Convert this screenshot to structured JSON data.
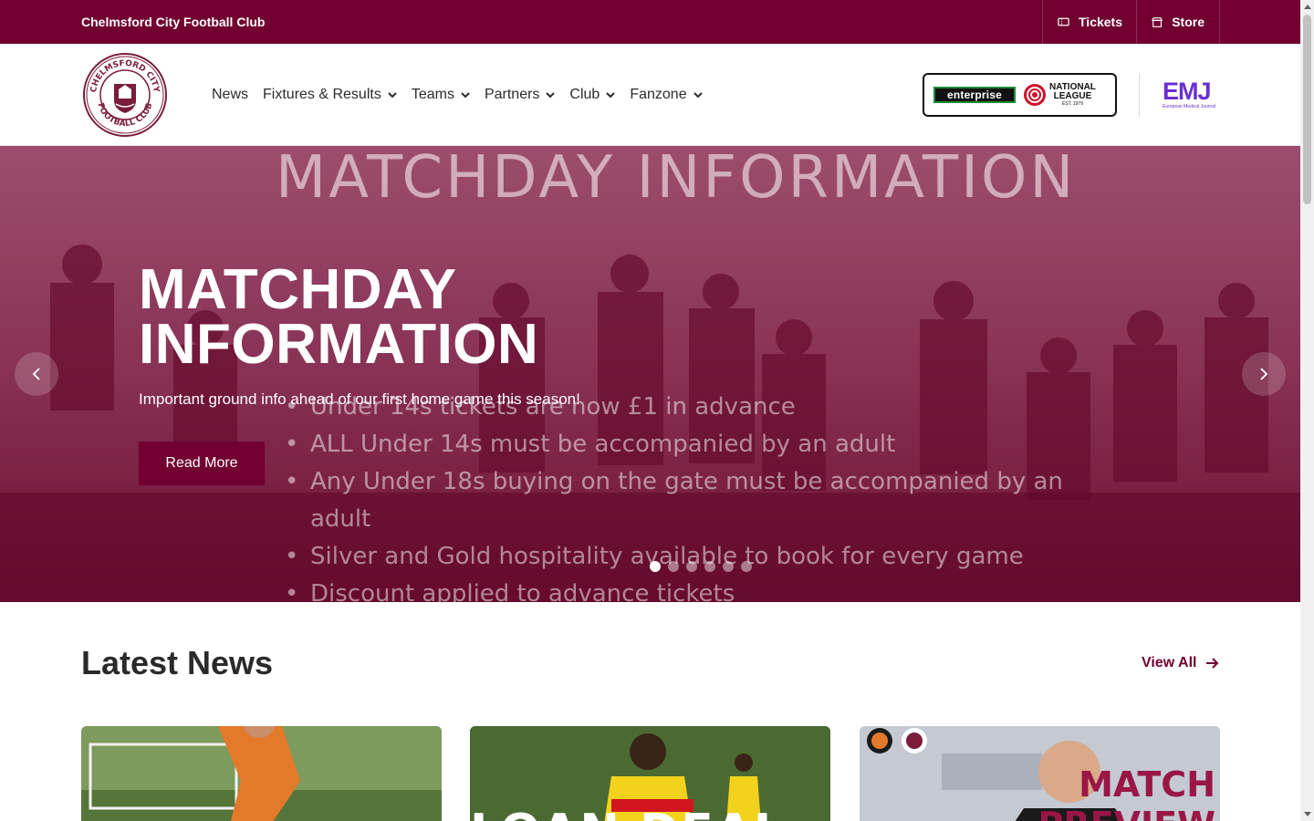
{
  "topbar": {
    "club_name": "Chelmsford City Football Club",
    "tickets_label": "Tickets",
    "store_label": "Store"
  },
  "header": {
    "crest_text": "CHELMSFORD CITY FOOTBALL CLUB",
    "nav": [
      {
        "label": "News",
        "has_dropdown": false
      },
      {
        "label": "Fixtures & Results",
        "has_dropdown": true
      },
      {
        "label": "Teams",
        "has_dropdown": true
      },
      {
        "label": "Partners",
        "has_dropdown": true
      },
      {
        "label": "Club",
        "has_dropdown": true
      },
      {
        "label": "Fanzone",
        "has_dropdown": true
      }
    ],
    "sponsor_enterprise": "enterprise",
    "sponsor_national_league": {
      "line1": "NATIONAL",
      "line2": "LEAGUE",
      "line3": "EST. 1979"
    },
    "sponsor_emj": {
      "mark": "EMJ",
      "sub": "European Medical Journal"
    }
  },
  "hero": {
    "background_heading": "MATCHDAY INFORMATION",
    "background_list": [
      "Under 14s tickets are now £1 in advance",
      "ALL Under 14s must be accompanied by an adult",
      "Any Under 18s buying on the gate must be accompanied by an adult",
      "Silver and Gold hospitality available to book for every game",
      "Discount applied to advance tickets"
    ],
    "title_line1": "MATCHDAY",
    "title_line2": "INFORMATION",
    "subtitle": "Important ground info ahead of our first home game this season!",
    "button_label": "Read More",
    "slide_count": 6,
    "active_slide": 0
  },
  "news": {
    "title": "Latest News",
    "view_all_label": "View All",
    "cards": [
      {
        "overlay_text": ""
      },
      {
        "overlay_text": "LOAN DEAL"
      },
      {
        "overlay_text": "MATCH PREVIEW"
      }
    ]
  },
  "colors": {
    "brand": "#710030",
    "emj": "#6a2fd0"
  }
}
